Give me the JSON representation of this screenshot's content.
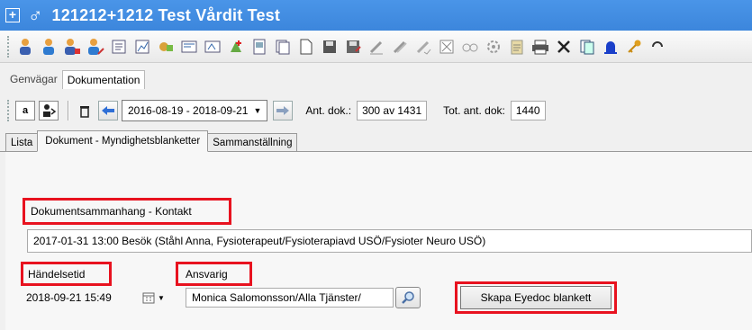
{
  "titlebar": {
    "expand": "+",
    "gender_symbol": "♂",
    "title": "121212+1212  Test Vårdit Test"
  },
  "menu": {
    "items": [
      "Genvägar",
      "Dokumentation"
    ],
    "active_index": 1
  },
  "nav": {
    "date_range": "2016-08-19 - 2018-09-21",
    "ant_dok_label": "Ant. dok.:",
    "ant_dok_value": "300 av 1431",
    "tot_ant_dok_label": "Tot. ant. dok:",
    "tot_ant_dok_value": "1440"
  },
  "tabs": {
    "items": [
      "Lista",
      "Dokument - Myndighetsblanketter",
      "Sammanställning"
    ],
    "active_index": 1
  },
  "form": {
    "context_label": "Dokumentsammanhang - Kontakt",
    "context_value": "2017-01-31 13:00 Besök (Ståhl Anna, Fysioterapeut/Fysioterapiavd USÖ/Fysioter Neuro USÖ)",
    "event_time_label": "Händelsetid",
    "event_time_value": "2018-09-21 15:49",
    "responsible_label": "Ansvarig",
    "responsible_value": "Monica Salomonsson/Alla Tjänster/",
    "create_button": "Skapa Eyedoc blankett"
  },
  "colors": {
    "titlebar": "#3c86dc",
    "highlight": "#e8121f"
  }
}
